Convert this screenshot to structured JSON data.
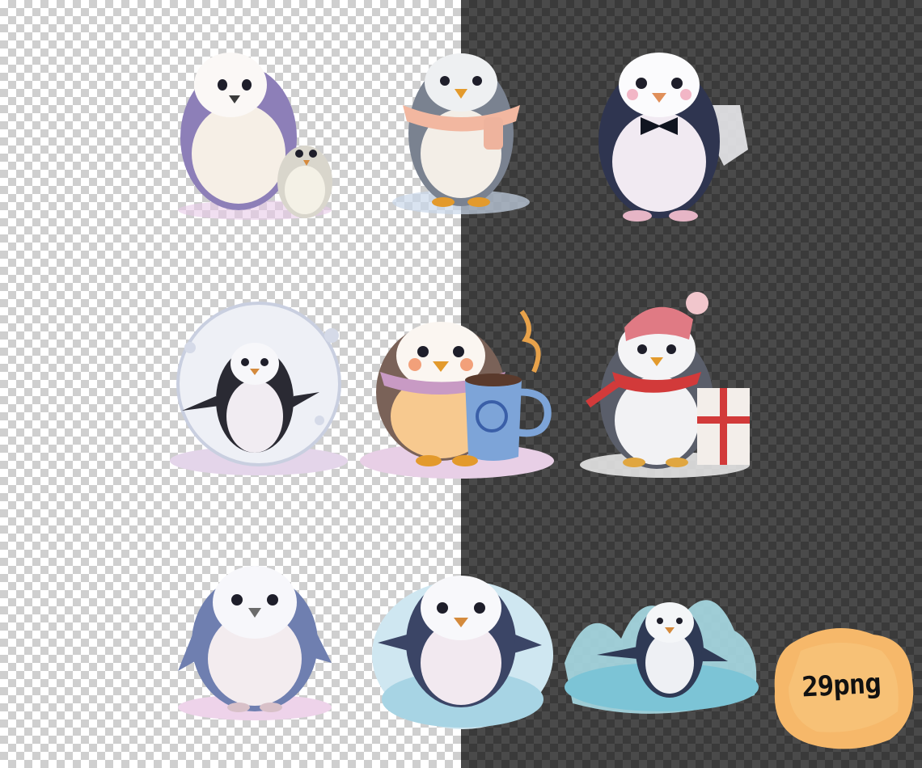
{
  "badge": {
    "label": "29png"
  },
  "colors": {
    "checker_light": "#ffffff",
    "checker_light_alt": "#cfcfcf",
    "checker_dark": "#4a4a4a",
    "checker_dark_alt": "#3a3a3a",
    "badge_fill": "#f6b86a"
  },
  "illustrations": [
    {
      "name": "penguin-mother-with-chick"
    },
    {
      "name": "penguin-with-scarf"
    },
    {
      "name": "penguin-with-bowtie"
    },
    {
      "name": "penguin-in-snow-globe"
    },
    {
      "name": "penguin-with-cocoa-mug"
    },
    {
      "name": "penguin-with-hat-and-gift"
    },
    {
      "name": "penguin-sitting"
    },
    {
      "name": "penguin-in-ice-splash"
    },
    {
      "name": "penguin-swimming"
    }
  ]
}
